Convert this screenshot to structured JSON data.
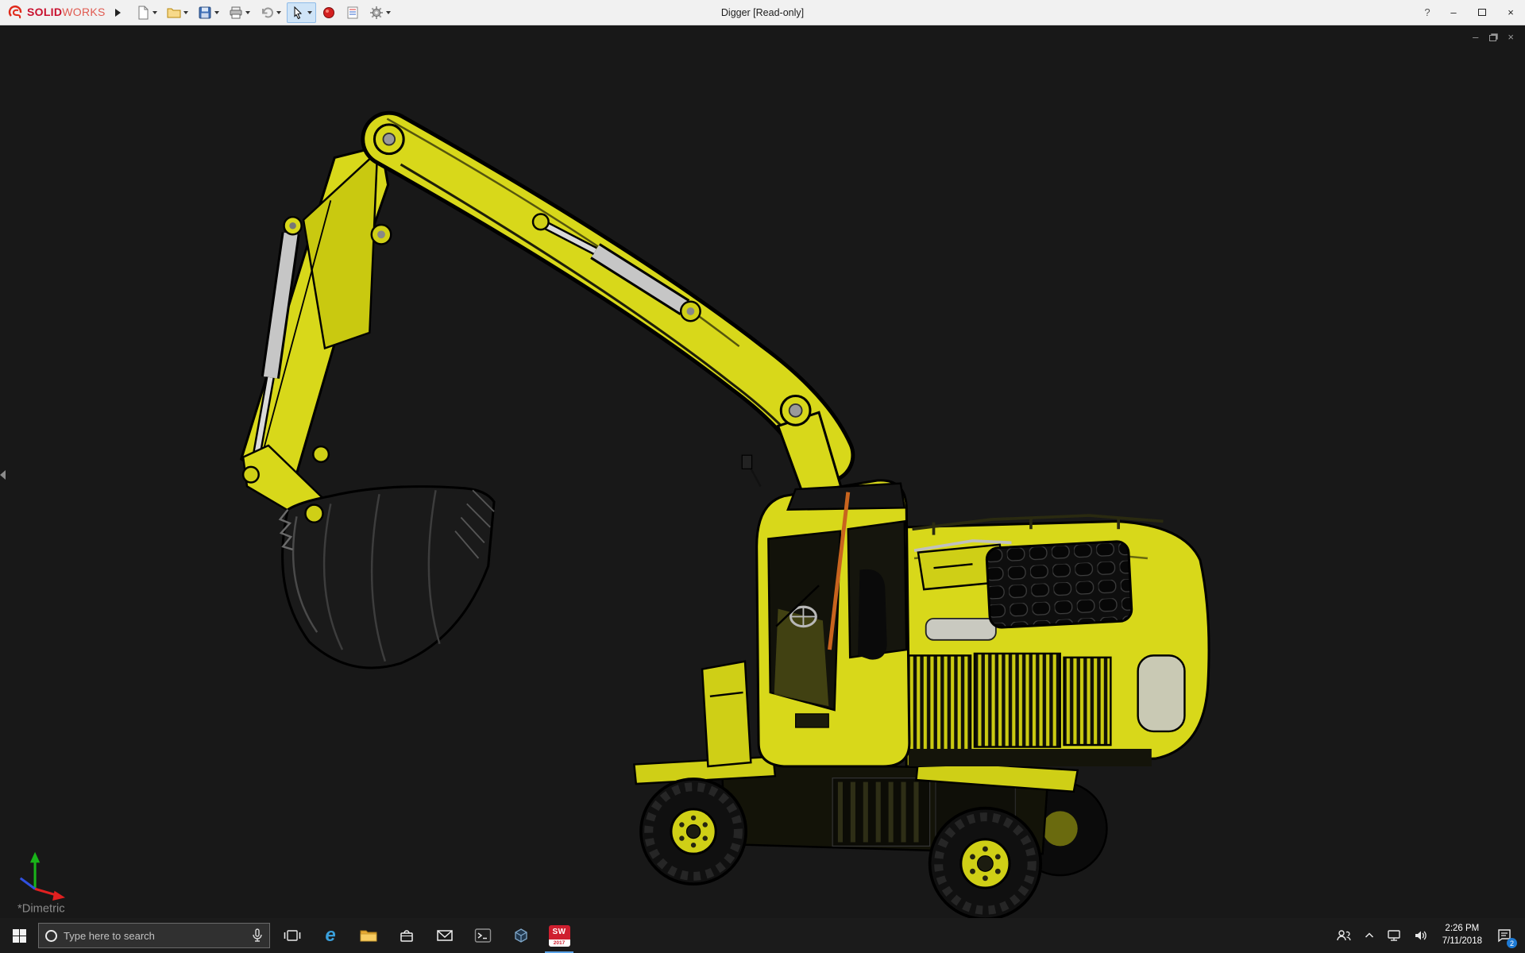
{
  "app": {
    "brand": {
      "solid": "SOLID",
      "works": "WORKS"
    },
    "title": "Digger [Read-only]",
    "window": {
      "help": "?",
      "minimize": "–",
      "close": "×"
    }
  },
  "toolbar": {
    "icons": [
      "new-document",
      "open-document",
      "save",
      "print",
      "undo",
      "select",
      "edit-appearance",
      "report",
      "options"
    ]
  },
  "viewport": {
    "view_label": "*Dimetric",
    "doc_window": {
      "minimize": "–",
      "close": "×"
    },
    "model": "Digger wheeled excavator",
    "colors": {
      "background": "#181818",
      "body_yellow": "#d8d81a",
      "edge_black": "#000000",
      "hydraulic_gray": "#c6c6c6",
      "glass_dark": "#12120a",
      "safety_pole_orange": "#c8641e"
    },
    "triad": {
      "x": "#e02020",
      "y": "#19b419",
      "z": "#3050e0"
    }
  },
  "taskbar": {
    "search_placeholder": "Type here to search",
    "icons": {
      "edge_glyph": "e"
    },
    "solidworks_badge": {
      "line1": "SW",
      "line2": "2017"
    },
    "tray": {
      "time": "2:26 PM",
      "date": "7/11/2018",
      "notification_count": "2"
    }
  }
}
